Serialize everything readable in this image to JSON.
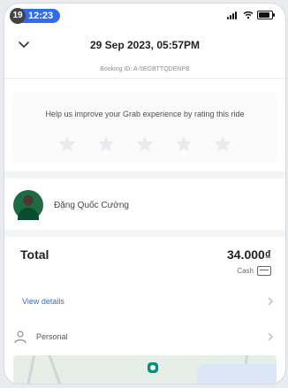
{
  "status_bar": {
    "notification_count": "19",
    "time": "12:23"
  },
  "header": {
    "title": "29 Sep 2023, 05:57PM"
  },
  "booking": {
    "text": "Booking ID: A-5EGBTTQDENPB"
  },
  "rating": {
    "prompt": "Help us improve your Grab experience by rating this ride",
    "stars_total": 5,
    "stars_selected": 0
  },
  "driver": {
    "name": "Đặng Quốc Cường"
  },
  "fare": {
    "label": "Total",
    "amount": "34.000₫",
    "payment_method": "Cash"
  },
  "links": {
    "view_details": "View details"
  },
  "trip_profile": {
    "label": "Personal"
  },
  "icons": {
    "chevron_down": "chevron-down-icon",
    "star": "star-icon",
    "chevron_right": "chevron-right-icon",
    "person": "person-icon",
    "cash": "cash-icon",
    "map_pin": "map-pin-icon"
  },
  "colors": {
    "accent_blue": "#2e6cf6",
    "link_blue": "#1a73e8",
    "map_pin": "#0a8f7d"
  }
}
